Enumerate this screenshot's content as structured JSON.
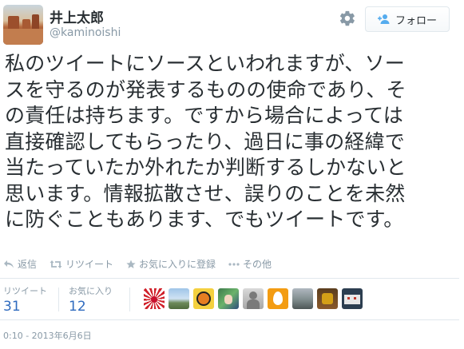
{
  "user": {
    "name": "井上太郎",
    "handle": "@kaminoishi"
  },
  "follow_button": {
    "label": "フォロー",
    "icon": "add-user-icon"
  },
  "settings": {
    "icon": "gear-icon"
  },
  "tweet_lines": [
    "私のツイートにソースといわれますが、ソー",
    "スを守るのが発表するものの使命であり、そ",
    "の責任は持ちます。ですから場合によっては",
    "直接確認してもらったり、過日に事の経緯で",
    "当たっていたか外れたか判断するしかないと",
    "思います。情報拡散させ、誤りのことを未然",
    "に防ぐこともあります、でもツイートです。"
  ],
  "actions": {
    "reply": "返信",
    "retweet": "リツイート",
    "favorite": "お気に入りに登録",
    "more": "その他"
  },
  "stats": {
    "retweets_label": "リツイート",
    "retweets_count": "31",
    "favorites_label": "お気に入り",
    "favorites_count": "12"
  },
  "favoriter_avatars": [
    "rising-sun-flag-avatar",
    "landscape-avatar",
    "sun-face-avatar",
    "anime-character-avatar",
    "gray-figure-avatar",
    "orange-egg-avatar",
    "cityscape-avatar",
    "golden-cup-avatar",
    "pixel-character-avatar"
  ],
  "timestamp": "0:10 - 2013年6月6日",
  "colors": {
    "link": "#2f6bbf",
    "muted": "#8899a6",
    "text": "#292f33",
    "border": "#e1e8ed"
  }
}
